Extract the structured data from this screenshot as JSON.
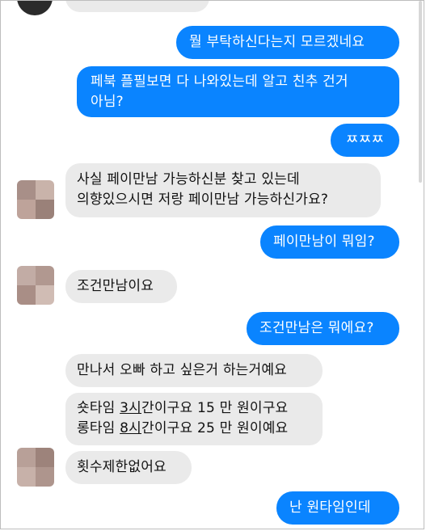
{
  "top_partial_text": "...",
  "messages": [
    {
      "side": "out",
      "text": "뭘 부탁하신다는지 모르겠네요"
    },
    {
      "side": "out",
      "lines": [
        "페북 플필보면 다 나와있는데 알고 친추 건거",
        "아님?"
      ]
    },
    {
      "side": "out",
      "text": "ㅉㅉㅉ"
    },
    {
      "side": "in",
      "lines": [
        "사실 페이만남 가능하신분 찾고 있는데",
        "의향있으시면 저랑 페이만남 가능하신가요?"
      ]
    },
    {
      "side": "out",
      "text": "페이만남이 뭐임?"
    },
    {
      "side": "in",
      "text": "조건만남이요"
    },
    {
      "side": "out",
      "text": "조건만남은 뭐에요?"
    },
    {
      "side": "in",
      "text": "만나서 오빠 하고 싶은거 하는거예요"
    },
    {
      "side": "in",
      "line1": {
        "a": "숏타임 ",
        "u": "3시",
        "b": "간이구요 15 만 원이구요"
      },
      "line2": {
        "a": "롱타임 ",
        "u": "8시",
        "b": "간이구요 25 만 원이예요"
      }
    },
    {
      "side": "in",
      "text": "횟수제한없어요"
    },
    {
      "side": "out",
      "text": "난 원타임인데"
    }
  ],
  "colors": {
    "outgoing": "#0a84ff",
    "incoming": "#eaeaea",
    "avatar_blur": "#b89a90"
  }
}
